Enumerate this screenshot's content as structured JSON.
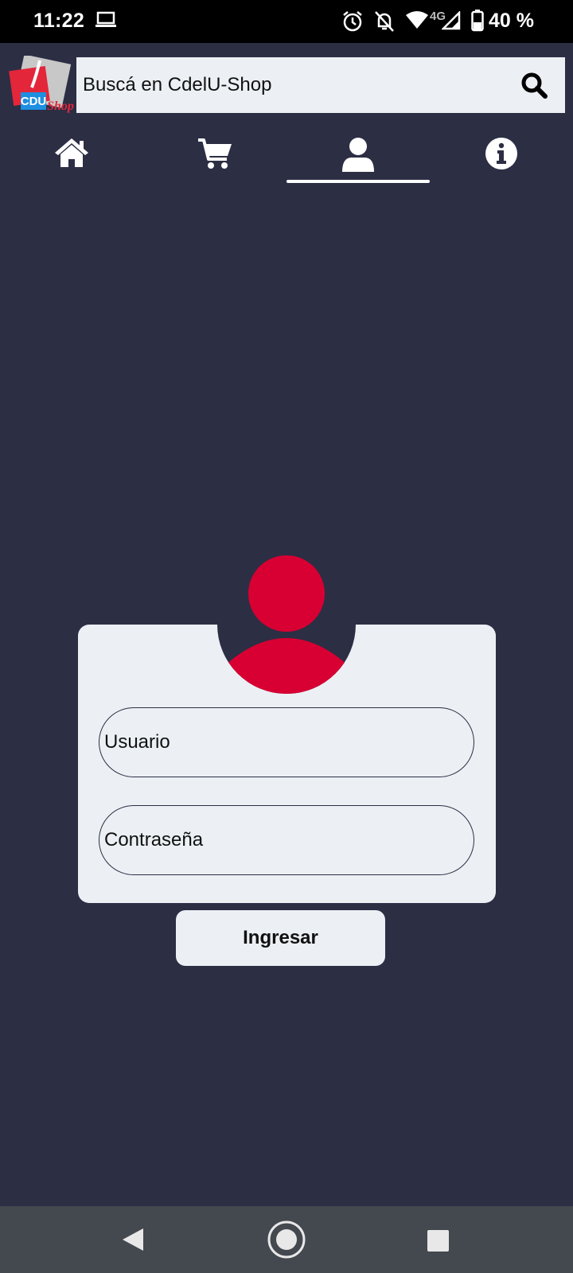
{
  "status_bar": {
    "time": "11:22",
    "network": "4G",
    "battery": "40 %"
  },
  "search": {
    "placeholder": "Buscá en CdelU-Shop"
  },
  "logo": {
    "text_top": "CDU",
    "text_bottom": "Shop"
  },
  "nav": {
    "tabs": [
      {
        "name": "home",
        "icon": "home-icon"
      },
      {
        "name": "cart",
        "icon": "cart-icon"
      },
      {
        "name": "account",
        "icon": "user-icon",
        "active": true
      },
      {
        "name": "info",
        "icon": "info-icon"
      }
    ]
  },
  "login": {
    "user_placeholder": "Usuario",
    "password_placeholder": "Contraseña",
    "submit_label": "Ingresar"
  },
  "colors": {
    "background": "#2c2e44",
    "card": "#ecf0f4",
    "avatar": "#d80032"
  }
}
